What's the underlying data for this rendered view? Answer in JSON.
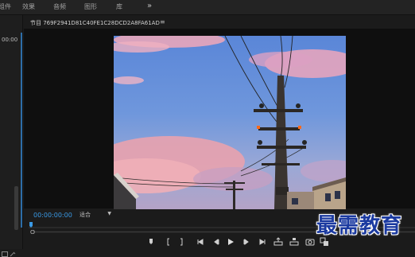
{
  "workspace_tabs": [
    "组件",
    "效果",
    "音频",
    "图形",
    "库"
  ],
  "workspace_more": "»",
  "left_panel": {
    "timecode": "00:00"
  },
  "program_monitor": {
    "title": "节目 769F2941D81C40FE1C28DCD2A8FA61AD",
    "menu": "≡",
    "timecode": "00:00:00:00",
    "fit": "适合",
    "video_description": "electricity-pole-at-sunset"
  },
  "controls": [
    "marker-icon",
    "mark-in-icon",
    "mark-out-icon",
    "go-to-in-icon",
    "step-back-icon",
    "play-icon",
    "step-forward-icon",
    "go-to-out-icon",
    "insert-icon",
    "overwrite-icon",
    "export-frame-icon",
    "compare-icon"
  ],
  "watermark": "最需教育",
  "colors": {
    "accent": "#3a9ae6",
    "bg": "#1b1b1b",
    "watermark": "#1b3aa0"
  }
}
